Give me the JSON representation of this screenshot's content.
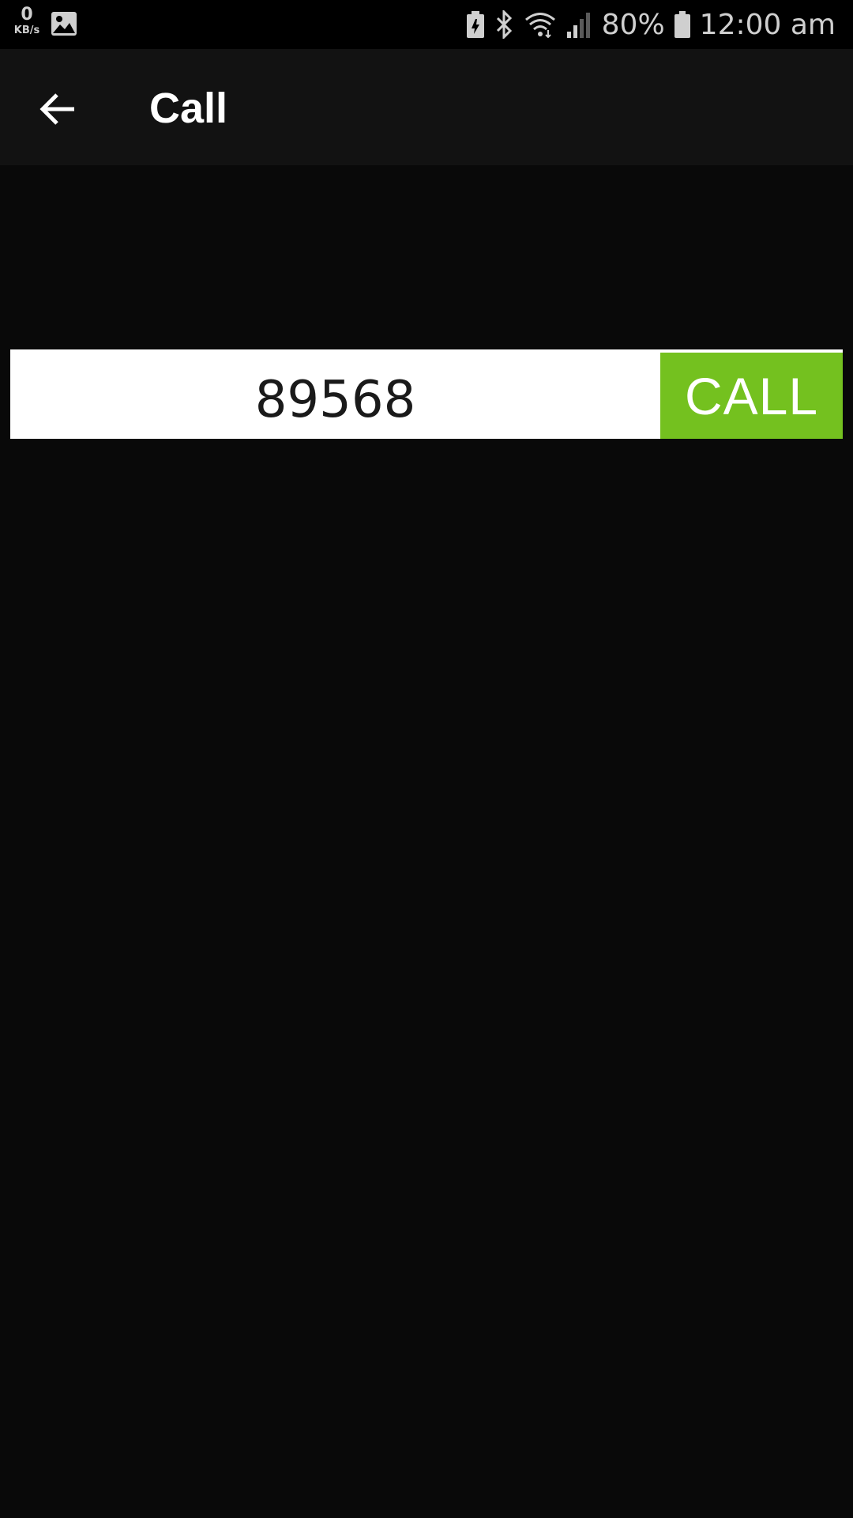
{
  "status_bar": {
    "net_speed_value": "0",
    "net_speed_unit": "KB/s",
    "battery_percent": "80%",
    "time": "12:00 am"
  },
  "app_bar": {
    "title": "Call"
  },
  "dialer": {
    "number": "89568",
    "call_label": "CALL"
  },
  "colors": {
    "background": "#090909",
    "app_bar": "#121212",
    "call_button": "#74c11f"
  }
}
